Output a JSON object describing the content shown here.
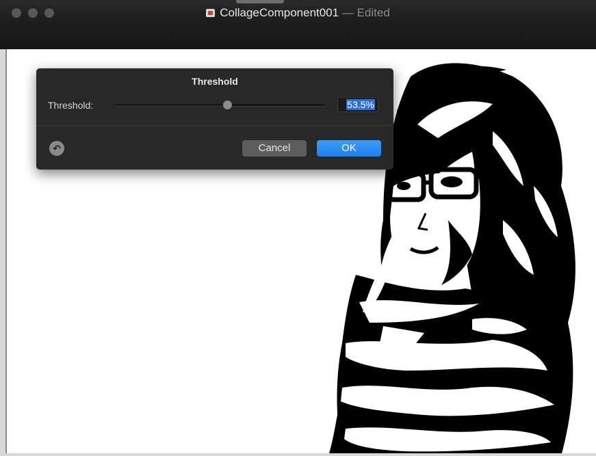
{
  "window": {
    "title": "CollageComponent001",
    "status": " — Edited",
    "controls": [
      "close-button",
      "minimize-button",
      "zoom-button"
    ]
  },
  "sheet": {
    "title": "Threshold",
    "threshold_label": "Threshold:",
    "threshold_value": "53.5%",
    "threshold_fraction": 0.535,
    "reset_icon": "↶",
    "cancel_label": "Cancel",
    "ok_label": "OK"
  },
  "colors": {
    "accent": "#2f7ff0",
    "sheet_bg": "#282828",
    "titlebar_bg": "#1e1e1e"
  }
}
